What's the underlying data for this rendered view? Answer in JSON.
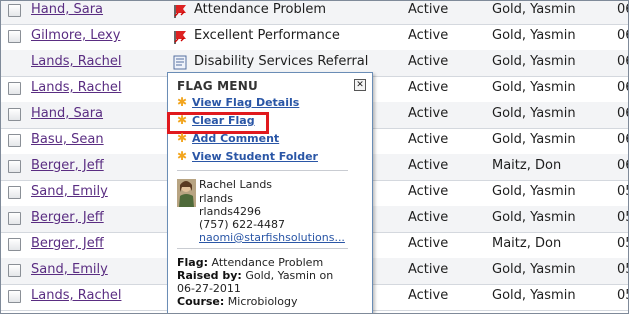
{
  "rows": [
    {
      "name": "Hand, Sara",
      "icon": "red-flag-icon",
      "flag": "Attendance Problem",
      "status": "Active",
      "raised_by": "Gold, Yasmin",
      "trunc": "06"
    },
    {
      "name": "Gilmore, Lexy",
      "icon": "red-flag-icon",
      "flag": "Excellent Performance",
      "status": "Active",
      "raised_by": "Gold, Yasmin",
      "trunc": "06"
    },
    {
      "name": "Lands, Rachel",
      "icon": "note-icon",
      "flag": "Disability Services Referral",
      "status": "Active",
      "raised_by": "Gold, Yasmin",
      "trunc": "06"
    },
    {
      "name": "Lands, Rachel",
      "icon": "",
      "flag": "",
      "status": "Active",
      "raised_by": "Gold, Yasmin",
      "trunc": "06"
    },
    {
      "name": "Hand, Sara",
      "icon": "",
      "flag": "",
      "status": "Active",
      "raised_by": "Gold, Yasmin",
      "trunc": "06"
    },
    {
      "name": "Basu, Sean",
      "icon": "",
      "flag": "",
      "status": "Active",
      "raised_by": "Gold, Yasmin",
      "trunc": "06"
    },
    {
      "name": "Berger, Jeff",
      "icon": "",
      "flag": "",
      "status": "Active",
      "raised_by": "Maitz, Don",
      "trunc": "06"
    },
    {
      "name": "Sand, Emily",
      "icon": "",
      "flag": "",
      "status": "Active",
      "raised_by": "Gold, Yasmin",
      "trunc": "05"
    },
    {
      "name": "Berger, Jeff",
      "icon": "",
      "flag": "",
      "status": "Active",
      "raised_by": "Gold, Yasmin",
      "trunc": "05"
    },
    {
      "name": "Berger, Jeff",
      "icon": "",
      "flag": "",
      "status": "Active",
      "raised_by": "Maitz, Don",
      "trunc": "05"
    },
    {
      "name": "Sand, Emily",
      "icon": "",
      "flag": "",
      "status": "Active",
      "raised_by": "Gold, Yasmin",
      "trunc": "05"
    },
    {
      "name": "Lands, Rachel",
      "icon": "",
      "flag": "",
      "status": "Active",
      "raised_by": "Gold, Yasmin",
      "trunc": "05"
    }
  ],
  "menu": {
    "title": "FLAG MENU",
    "close": "✕",
    "items": [
      "View Flag Details",
      "Clear Flag",
      "Add Comment",
      "View Student Folder"
    ],
    "student": {
      "name": "Rachel Lands",
      "username": "rlands",
      "id": "rlands4296",
      "phone": "(757) 622-4487",
      "email": "naomi@starfishsolutions..."
    },
    "flag_label": "Flag:",
    "flag_value": "Attendance Problem",
    "raised_label": "Raised by:",
    "raised_value": "Gold, Yasmin on",
    "raised_date": "06-27-2011",
    "course_label": "Course:",
    "course_value": "Microbiology"
  },
  "colors": {
    "link": "#5a2d82",
    "menu_link": "#2a56a6",
    "highlight": "#e0191e",
    "star": "#f2a51e"
  }
}
